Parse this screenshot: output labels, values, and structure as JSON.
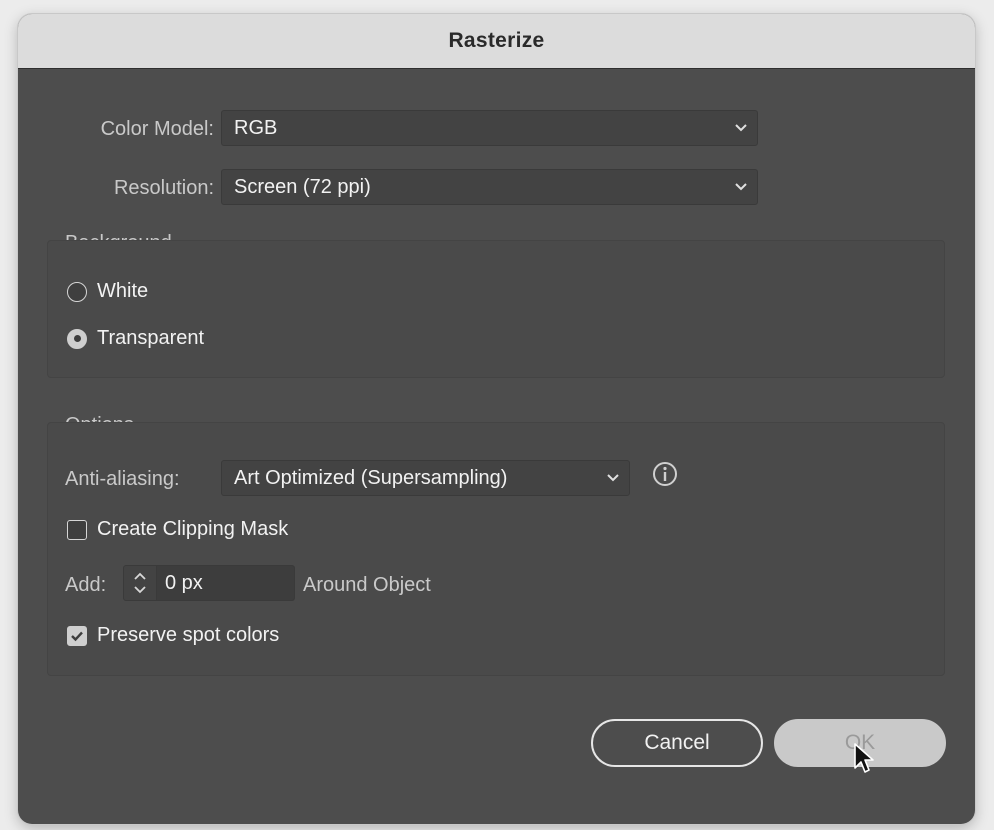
{
  "dialog": {
    "title": "Rasterize"
  },
  "color_model": {
    "label": "Color Model:",
    "value": "RGB"
  },
  "resolution": {
    "label": "Resolution:",
    "value": "Screen (72 ppi)"
  },
  "background": {
    "title": "Background",
    "options": [
      {
        "label": "White",
        "selected": false
      },
      {
        "label": "Transparent",
        "selected": true
      }
    ]
  },
  "options": {
    "title": "Options",
    "anti_aliasing": {
      "label": "Anti-aliasing:",
      "value": "Art Optimized (Supersampling)"
    },
    "clipping_mask": {
      "label": "Create Clipping Mask",
      "checked": false
    },
    "add": {
      "label": "Add:",
      "value": "0 px",
      "suffix": "Around Object"
    },
    "spot_colors": {
      "label": "Preserve spot colors",
      "checked": true
    }
  },
  "buttons": {
    "cancel": "Cancel",
    "ok": "OK"
  }
}
